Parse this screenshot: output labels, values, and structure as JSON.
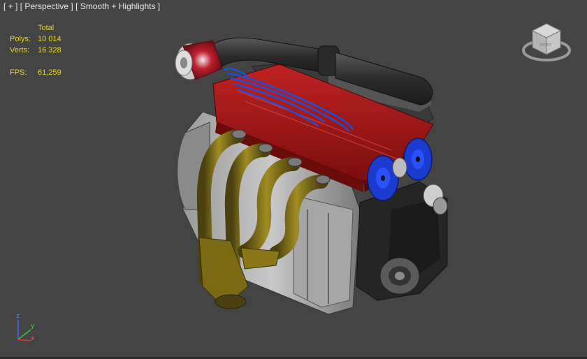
{
  "viewport": {
    "label_parts": [
      "[ + ]",
      "[ Perspective ]",
      "[ Smooth + Highlights ]"
    ]
  },
  "stats": {
    "header": "Total",
    "polys_label": "Polys:",
    "polys_value": "10 014",
    "verts_label": "Verts:",
    "verts_value": "16 328",
    "fps_label": "FPS:",
    "fps_value": "61,259"
  },
  "axes": {
    "x": "x",
    "y": "y",
    "z": "z"
  },
  "colors": {
    "background": "#444444",
    "stats_text": "#e6d42a",
    "valve_cover": "#a01818",
    "exhaust_header": "#7a6a14",
    "ignition_wires": "#1f4fd8",
    "cam_gear": "#1c3ccf",
    "air_filter": "#c02030"
  }
}
